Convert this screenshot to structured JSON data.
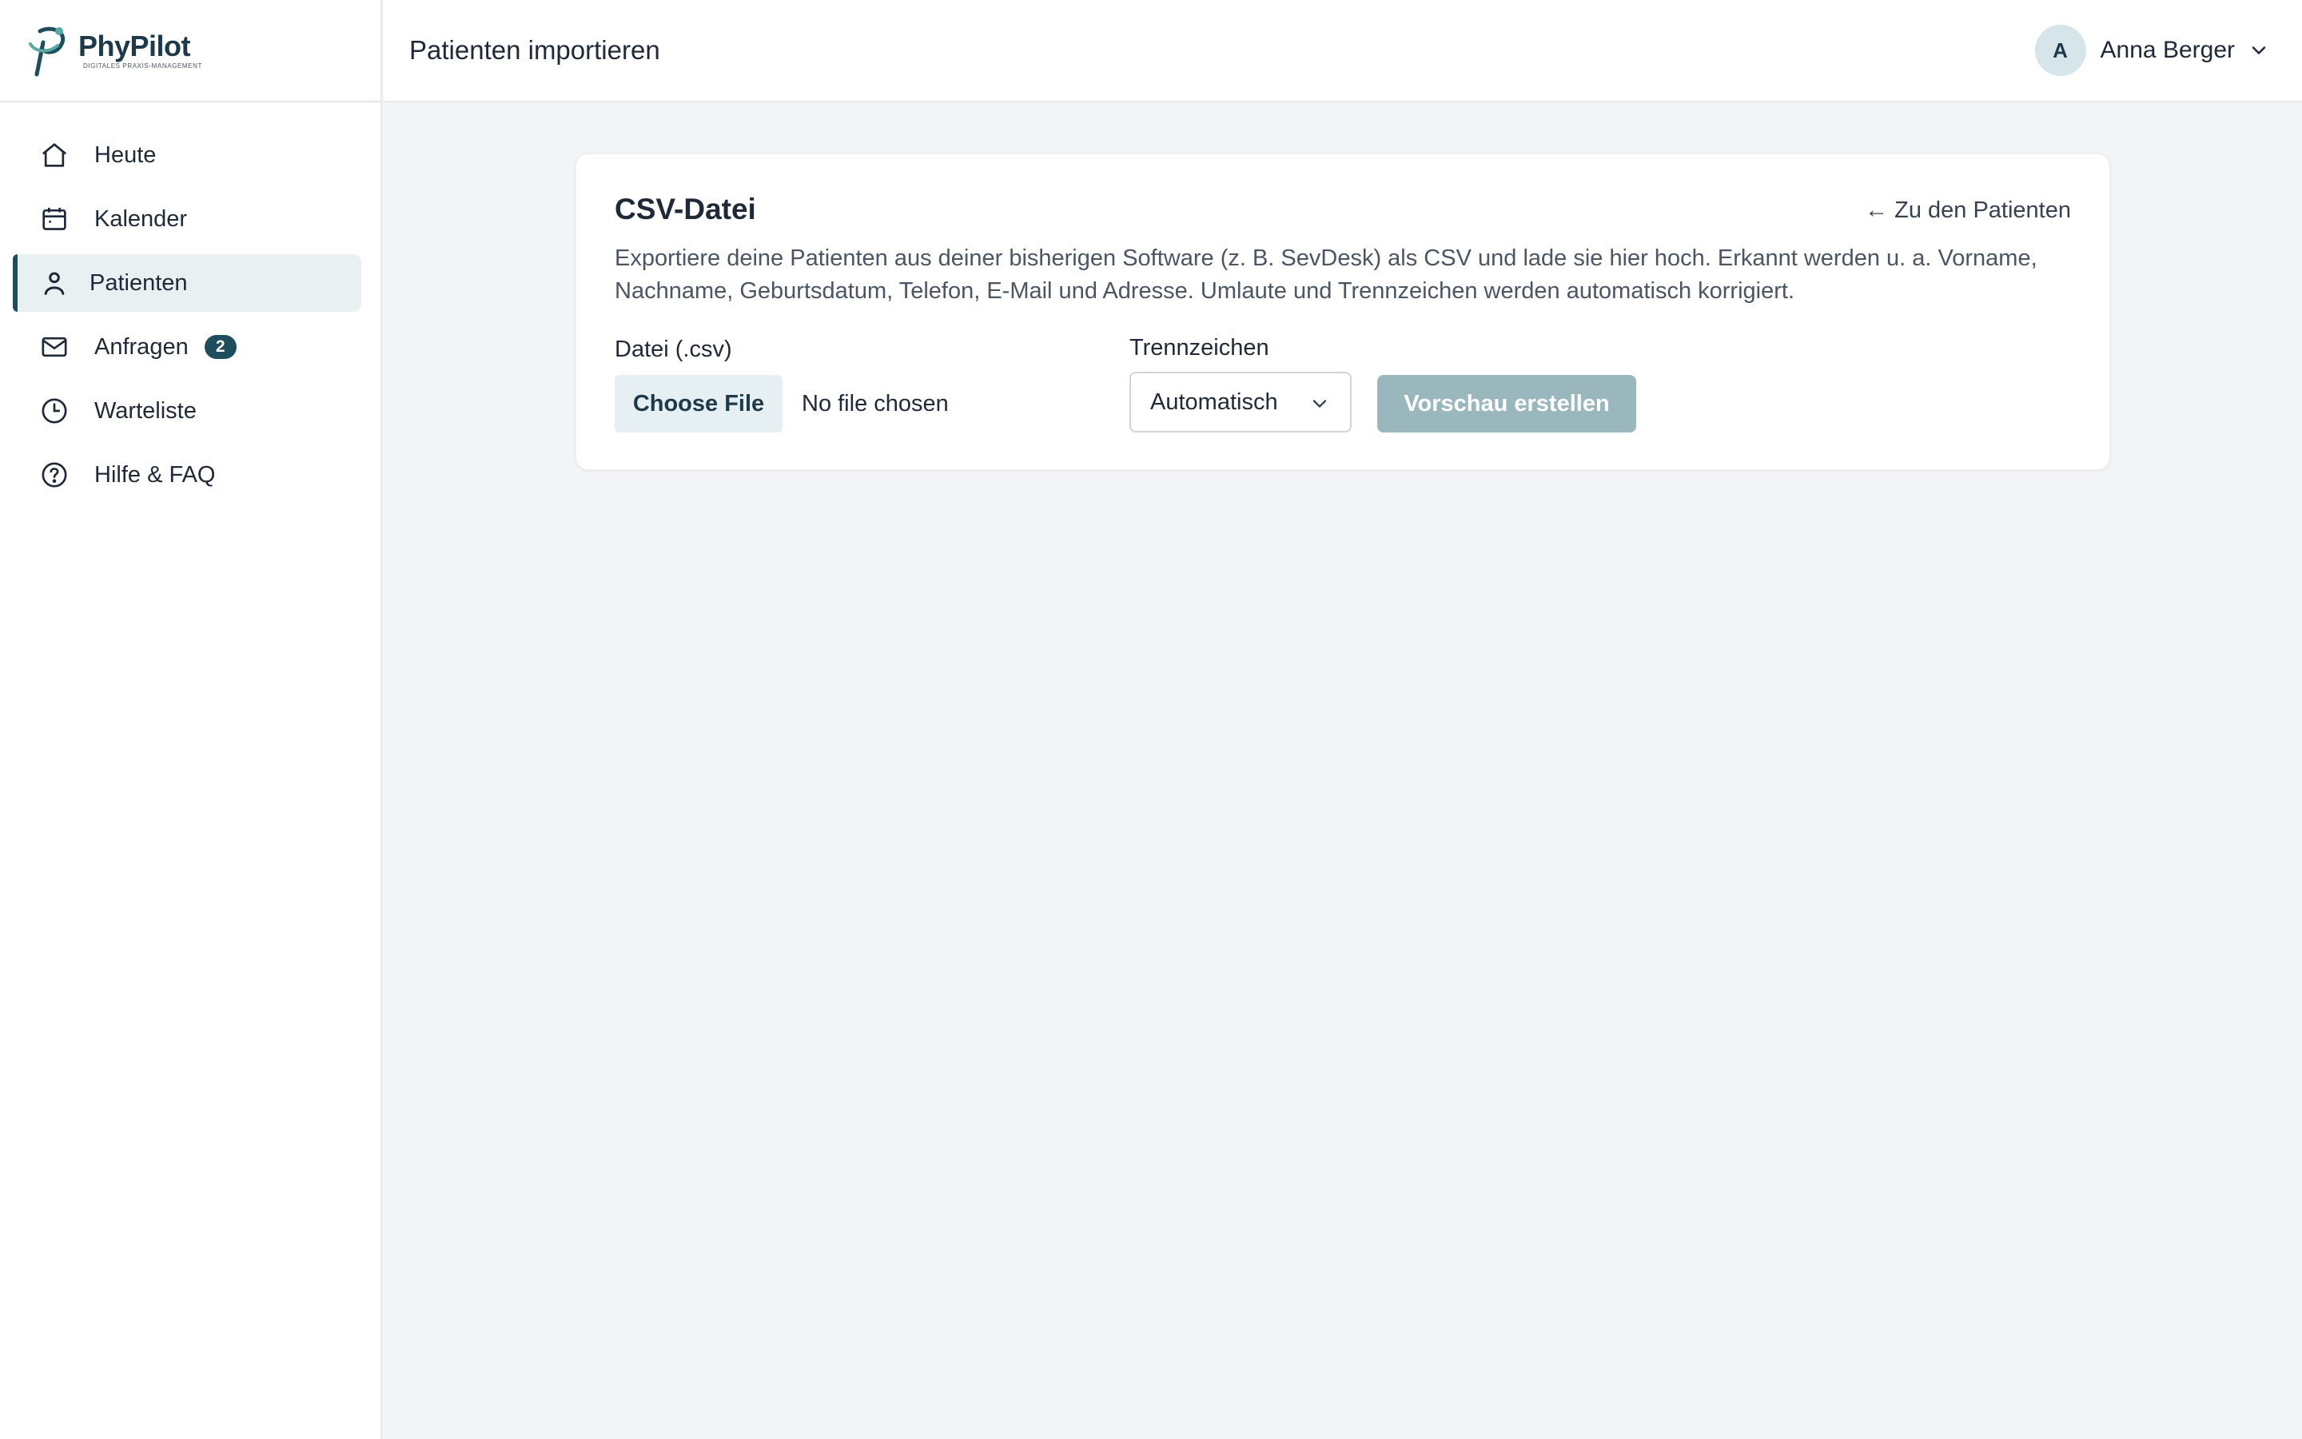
{
  "brand": {
    "name": "PhyPilot",
    "tagline": "DIGITALES PRAXIS-MANAGEMENT",
    "accent": "#1e4d5c"
  },
  "sidebar": {
    "items": [
      {
        "label": "Heute",
        "icon": "home-icon",
        "active": false
      },
      {
        "label": "Kalender",
        "icon": "calendar-icon",
        "active": false
      },
      {
        "label": "Patienten",
        "icon": "person-icon",
        "active": true
      },
      {
        "label": "Anfragen",
        "icon": "mail-icon",
        "active": false,
        "badge": "2"
      },
      {
        "label": "Warteliste",
        "icon": "clock-icon",
        "active": false
      },
      {
        "label": "Hilfe & FAQ",
        "icon": "help-circle-icon",
        "active": false
      }
    ]
  },
  "header": {
    "title": "Patienten importieren",
    "user": {
      "initial": "A",
      "name": "Anna Berger"
    }
  },
  "card": {
    "title": "CSV-Datei",
    "back_link": "← Zu den Patienten",
    "description": "Exportiere deine Patienten aus deiner bisherigen Software (z. B. SevDesk) als CSV und lade sie hier hoch. Erkannt werden u. a. Vorname, Nachname, Geburtsdatum, Telefon, E-Mail und Adresse. Umlaute und Trennzeichen werden automatisch korrigiert.",
    "file_label": "Datei (.csv)",
    "file_button": "Choose File",
    "file_status": "No file chosen",
    "separator_label": "Trennzeichen",
    "separator_value": "Automatisch",
    "preview_button": "Vorschau erstellen"
  }
}
